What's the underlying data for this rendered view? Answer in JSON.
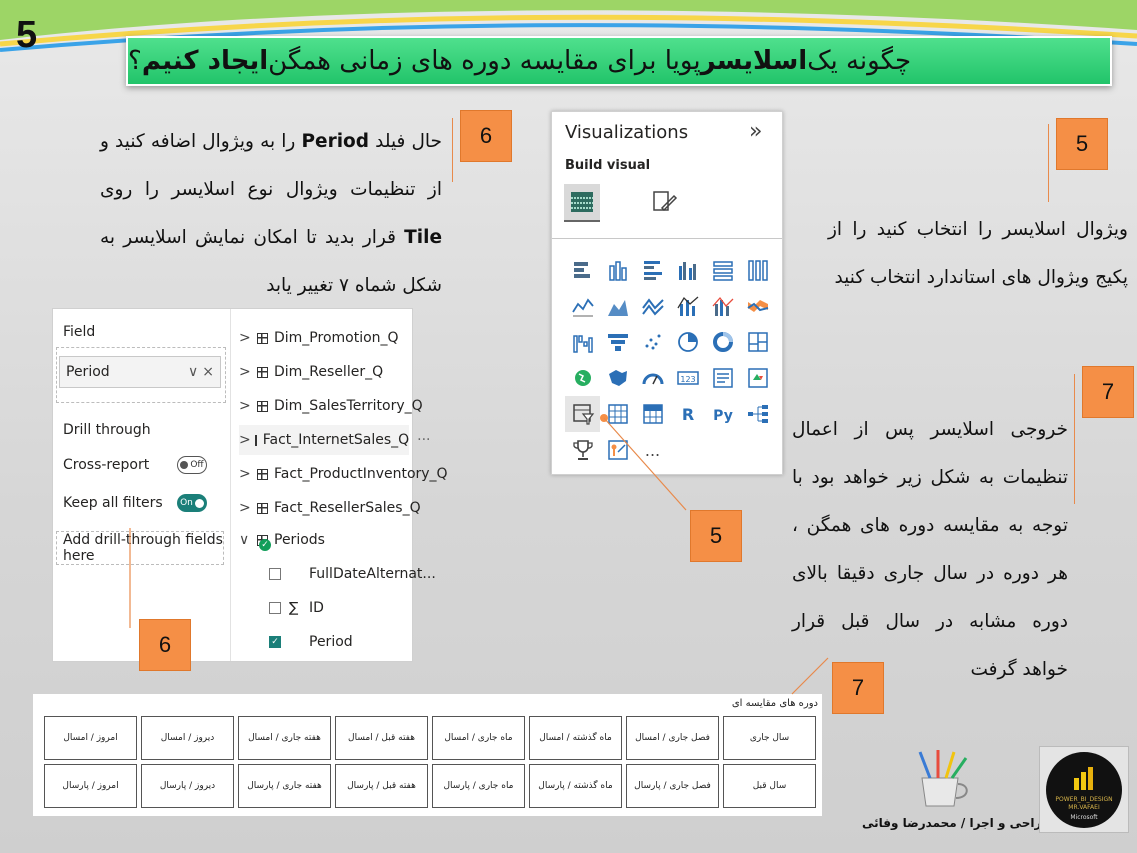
{
  "slide_number": "5",
  "title": {
    "part1": "چگونه یک ",
    "bold1": "اسلایسر",
    "part2": " پویا برای مقایسه دوره های زمانی همگن ",
    "bold2": "ایجاد کنیم",
    "part3": " ؟"
  },
  "step6": {
    "badge": "6",
    "t1": "حال فیلد ",
    "field": "Period",
    "t2": " را به ویژوال اضافه کنید و از تنظیمات ویژوال نوع اسلایسر را روی ",
    "tile": "Tile",
    "t3": " قرار بدید تا امکان نمایش اسلایسر به شکل شماه ۷ تغییر یابد"
  },
  "step5": {
    "badge": "5",
    "text": "ویژوال اسلایسر را انتخاب کنید را از پکیج ویژوال های استاندارد انتخاب کنید"
  },
  "step7": {
    "badge": "7",
    "text": "خروجی اسلایسر پس از اعمال تنظیمات به شکل زیر خواهد بود با توجه به مقایسه دوره های همگن ، هر دوره در سال جاری دقیقا بالای دوره مشابه در سال قبل قرار خواهد گرفت"
  },
  "callouts": {
    "five": "5",
    "six": "6",
    "seven": "7"
  },
  "visualizations": {
    "title": "Visualizations",
    "expand_icon": "double-chevron-right",
    "build_visual": "Build visual",
    "more": "...",
    "icons": [
      "stacked-bar",
      "stacked-column",
      "clustered-bar",
      "clustered-column",
      "100-bar",
      "100-column",
      "line",
      "area",
      "stacked-area",
      "line-column",
      "line-clustered-column",
      "ribbon",
      "waterfall",
      "funnel",
      "scatter",
      "pie",
      "donut",
      "treemap",
      "map",
      "filled-map",
      "gauge",
      "card",
      "multi-row-card",
      "kpi",
      "slicer",
      "table",
      "matrix",
      "r-visual",
      "python-visual",
      "decomposition-tree",
      "trophy",
      "smart-narrative"
    ]
  },
  "field_well": {
    "field_label": "Field",
    "field_value": "Period",
    "drill_through": "Drill through",
    "cross_report": "Cross-report",
    "cross_report_state": "Off",
    "keep_filters": "Keep all filters",
    "keep_filters_state": "On",
    "add_drill": "Add drill-through fields here"
  },
  "tables": [
    "Dim_Promotion_Q",
    "Dim_Reseller_Q",
    "Dim_SalesTerritory_Q",
    "Fact_InternetSales_Q",
    "Fact_ProductInventory_Q",
    "Fact_ResellerSales_Q"
  ],
  "table_more": "···",
  "periods": {
    "name": "Periods",
    "fields": [
      {
        "label": "FullDateAlternat...",
        "sigma": "",
        "checked": false
      },
      {
        "label": "ID",
        "sigma": "∑",
        "checked": false
      },
      {
        "label": "Period",
        "sigma": "",
        "checked": true
      }
    ]
  },
  "slicer": {
    "title": "دوره های مقایسه ای",
    "row1": [
      "سال جاری",
      "فصل جاری / امسال",
      "ماه گذشته / امسال",
      "ماه جاری / امسال",
      "هفته قبل / امسال",
      "هفته جاری / امسال",
      "دیروز / امسال",
      "امروز / امسال"
    ],
    "row2": [
      "سال قبل",
      "فصل جاری / پارسال",
      "ماه گذشته / پارسال",
      "ماه جاری / پارسال",
      "هفته قبل / پارسال",
      "هفته جاری / پارسال",
      "دیروز / پارسال",
      "امروز / پارسال"
    ]
  },
  "credit": "طراحی و اجرا / محمدرضا وفائی",
  "logo": {
    "top": "POWER_BI_DESIGN",
    "mid": "MR.VAFAEI",
    "brand": "Microsoft"
  },
  "colors": {
    "accent": "#f58f46",
    "title_green": "#2ecf78",
    "slicer_on": "#1b7f79"
  }
}
